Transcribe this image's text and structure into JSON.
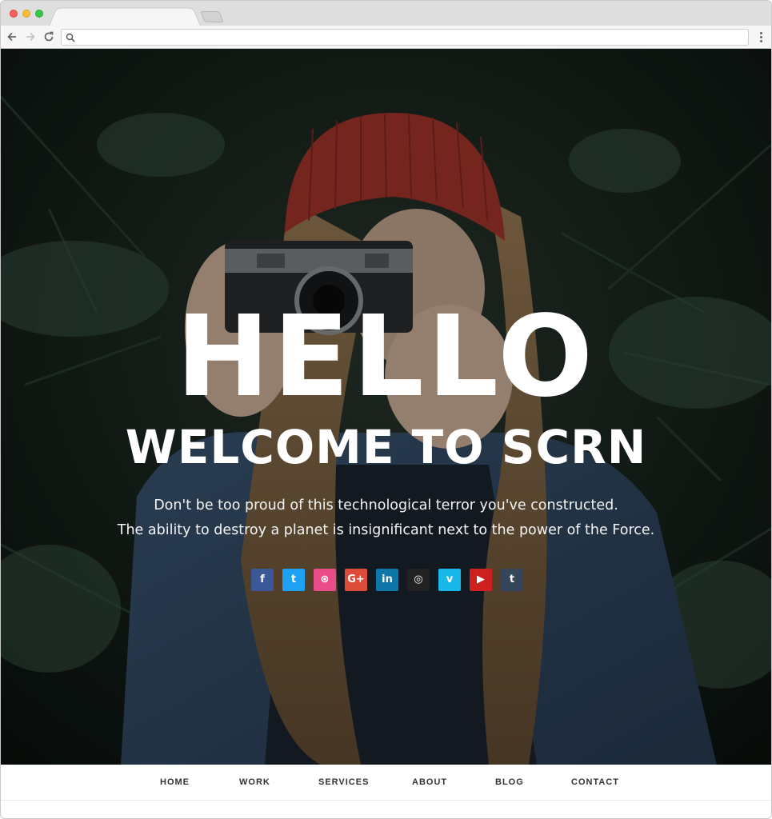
{
  "browser": {
    "tab_title": "",
    "address": "",
    "colors": {
      "close": "#fc605c",
      "minimize": "#fdbc40",
      "zoom": "#34c84a"
    },
    "icons": {
      "back": "arrow-left-icon",
      "forward": "arrow-right-icon",
      "reload": "reload-icon",
      "search": "search-icon",
      "menu": "kebab-menu-icon"
    }
  },
  "hero": {
    "title": "HELLO",
    "subtitle": "WELCOME TO SCRN",
    "tagline_line1": "Don't be too proud of this technological terror you've constructed.",
    "tagline_line2": "The ability to destroy a planet is insignificant next to the power of the Force."
  },
  "socials": [
    {
      "name": "facebook",
      "glyph": "f",
      "color": "#3b5998"
    },
    {
      "name": "twitter",
      "glyph": "t",
      "color": "#1da1f2"
    },
    {
      "name": "dribbble",
      "glyph": "⊛",
      "color": "#ea4c89"
    },
    {
      "name": "google-plus",
      "glyph": "G+",
      "color": "#dd4b39"
    },
    {
      "name": "linkedin",
      "glyph": "in",
      "color": "#0e76a8"
    },
    {
      "name": "instagram",
      "glyph": "◎",
      "color": "#222222"
    },
    {
      "name": "vimeo",
      "glyph": "v",
      "color": "#1ab7ea"
    },
    {
      "name": "youtube",
      "glyph": "▶",
      "color": "#cd201f"
    },
    {
      "name": "tumblr",
      "glyph": "t",
      "color": "#35465c"
    }
  ],
  "nav": {
    "items": [
      "HOME",
      "WORK",
      "SERVICES",
      "ABOUT",
      "BLOG",
      "CONTACT"
    ]
  }
}
